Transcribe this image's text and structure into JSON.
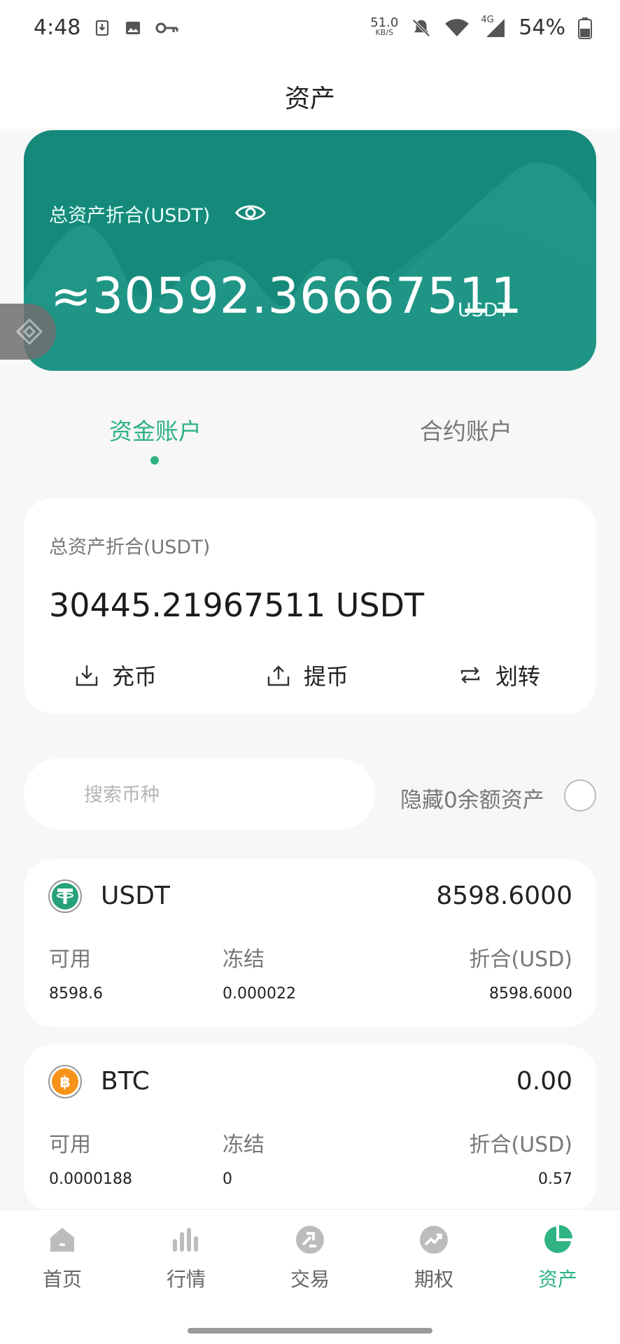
{
  "status_bar": {
    "time": "4:48",
    "net_speed_value": "51.0",
    "net_speed_unit": "KB/S",
    "network_type": "4G",
    "battery": "54%"
  },
  "header": {
    "title": "资产"
  },
  "hero": {
    "label": "总资产折合(USDT)",
    "amount": "≈30592.36667511",
    "unit": "USDT"
  },
  "tabs": [
    {
      "label": "资金账户",
      "active": true
    },
    {
      "label": "合约账户",
      "active": false
    }
  ],
  "account": {
    "label": "总资产折合(USDT)",
    "amount": "30445.21967511 USDT",
    "actions": [
      {
        "label": "充币",
        "icon": "deposit-icon"
      },
      {
        "label": "提币",
        "icon": "withdraw-icon"
      },
      {
        "label": "划转",
        "icon": "transfer-icon"
      }
    ]
  },
  "search": {
    "placeholder": "搜索币种"
  },
  "hide_zero": {
    "label": "隐藏0余额资产"
  },
  "coins": [
    {
      "name": "USDT",
      "total": "8598.6000",
      "available_label": "可用",
      "frozen_label": "冻结",
      "value_label": "折合(USD)",
      "available": "8598.6",
      "frozen": "0.000022",
      "value": "8598.6000"
    },
    {
      "name": "BTC",
      "total": "0.00",
      "available_label": "可用",
      "frozen_label": "冻结",
      "value_label": "折合(USD)",
      "available": "0.0000188",
      "frozen": "0",
      "value": "0.57"
    }
  ],
  "bottom_nav": [
    {
      "label": "首页",
      "icon": "home-icon",
      "active": false
    },
    {
      "label": "行情",
      "icon": "market-icon",
      "active": false
    },
    {
      "label": "交易",
      "icon": "trade-icon",
      "active": false
    },
    {
      "label": "期权",
      "icon": "options-icon",
      "active": false
    },
    {
      "label": "资产",
      "icon": "assets-icon",
      "active": true
    }
  ],
  "colors": {
    "accent": "#2fb383",
    "hero_bg": "#158a7a",
    "muted_text": "#777777",
    "card_bg": "#ffffff",
    "page_bg": "#f7f7f7"
  }
}
